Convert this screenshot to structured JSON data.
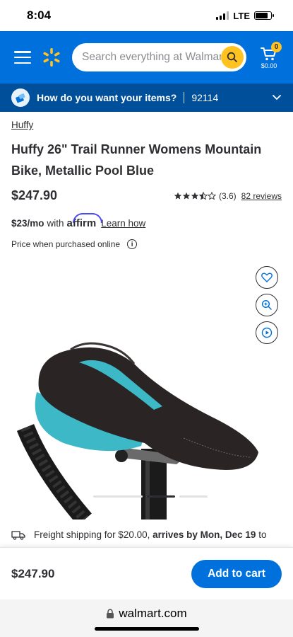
{
  "status_bar": {
    "time": "8:04",
    "network": "LTE"
  },
  "header": {
    "search_placeholder": "Search everything at Walmart online and in store",
    "cart_count": "0",
    "cart_total": "$0.00",
    "accent": "#0071dc",
    "spark_color": "#ffc220"
  },
  "delivery": {
    "question": "How do you want your items?",
    "zip": "92114"
  },
  "product": {
    "brand": "Huffy",
    "title": "Huffy 26\" Trail Runner Womens Mountain Bike, Metallic Pool Blue",
    "price": "$247.90",
    "rating": "(3.6)",
    "reviews": "82 reviews",
    "monthly": "$23/mo",
    "with": "with",
    "affirm": "affirm",
    "learn": "Learn how",
    "price_note": "Price when purchased online",
    "saddle_accent": "#3db8c6"
  },
  "shipping": {
    "text": "Freight shipping for $20.00,",
    "arrives": "arrives by Mon, Dec 19",
    "to": "to"
  },
  "sticky": {
    "price": "$247.90",
    "button": "Add to cart"
  },
  "browser": {
    "url": "walmart.com"
  }
}
